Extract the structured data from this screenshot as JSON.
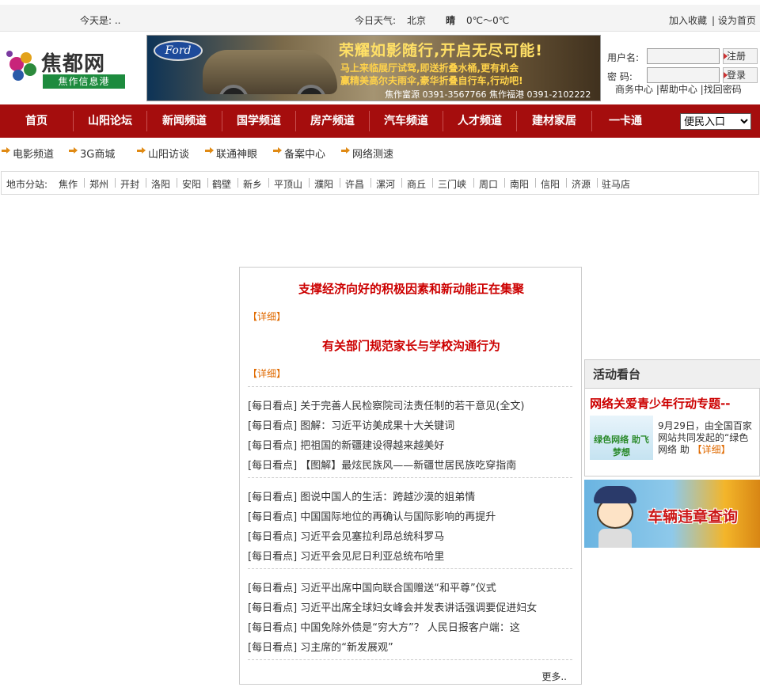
{
  "topbar": {
    "today": "今天是: ..",
    "weather_label": "今日天气:",
    "city": "北京",
    "condition": "晴",
    "temp": "0℃～0℃",
    "bookmark": "加入收藏",
    "homepage": "| 设为首页"
  },
  "logo": {
    "name": "焦都网",
    "tagline": "焦作信息港"
  },
  "banner": {
    "brand": "Ford",
    "headline": "荣耀如影随行,开启无尽可能!",
    "line1": "马上来临展厅试驾,即送折叠水桶,更有机会",
    "line2": "赢精美高尔夫雨伞,豪华折叠自行车,行动吧!",
    "contact": "焦作富源 0391-3567766  焦作福港 0391-2102222"
  },
  "login": {
    "user_label": "用户名:",
    "pass_label": "密  码:",
    "register": "注册",
    "login": "登录",
    "links": "商务中心 |帮助中心 |找回密码"
  },
  "nav": {
    "items": [
      "首页",
      "山阳论坛",
      "新闻频道",
      "国学频道",
      "房产频道",
      "汽车频道",
      "人才频道",
      "建材家居",
      "一卡通"
    ],
    "select": "便民入口"
  },
  "subnav": [
    "电影频道",
    "3G商城",
    "山阳访谈",
    "联通神眼",
    "备案中心",
    "网络测速"
  ],
  "cities": {
    "label": "地市分站:",
    "items": [
      "焦作",
      "郑州",
      "开封",
      "洛阳",
      "安阳",
      "鹤壁",
      "新乡",
      "平顶山",
      "濮阳",
      "许昌",
      "漯河",
      "商丘",
      "三门峡",
      "周口",
      "南阳",
      "信阳",
      "济源",
      "驻马店"
    ]
  },
  "news": {
    "headline1": "支撑经济向好的积极因素和新动能正在集聚",
    "headline2": "有关部门规范家长与学校沟通行为",
    "detail": "【详细】",
    "rows": [
      "[每日看点] 关于完善人民检察院司法责任制的若干意见(全文)",
      "[每日看点] 图解：习近平访美成果十大关键词",
      "[每日看点] 把祖国的新疆建设得越来越美好",
      "[每日看点] 【图解】最炫民族风——新疆世居民族吃穿指南",
      "[每日看点] 图说中国人的生活：跨越沙漠的姐弟情",
      "[每日看点] 中国国际地位的再确认与国际影响的再提升",
      "[每日看点] 习近平会见塞拉利昂总统科罗马",
      "[每日看点] 习近平会见尼日利亚总统布哈里",
      "[每日看点] 习近平出席中国向联合国赠送“和平尊”仪式",
      "[每日看点] 习近平出席全球妇女峰会并发表讲话强调要促进妇女",
      "[每日看点] 中国免除外债是“穷大方”？ 人民日报客户端：这",
      "[每日看点] 习主席的“新发展观”"
    ],
    "more": "更多.."
  },
  "side": {
    "title": "活动看台",
    "promo": "网络关爱青少年行动专题--",
    "text": "9月29日，由全国百家网站共同发起的“绿色网络 助",
    "detail": "【详细】"
  },
  "violation": "车辆违章查询",
  "colors": {
    "nav": "#a50d0d",
    "headline": "#cc0000",
    "accent": "#e06a00"
  }
}
